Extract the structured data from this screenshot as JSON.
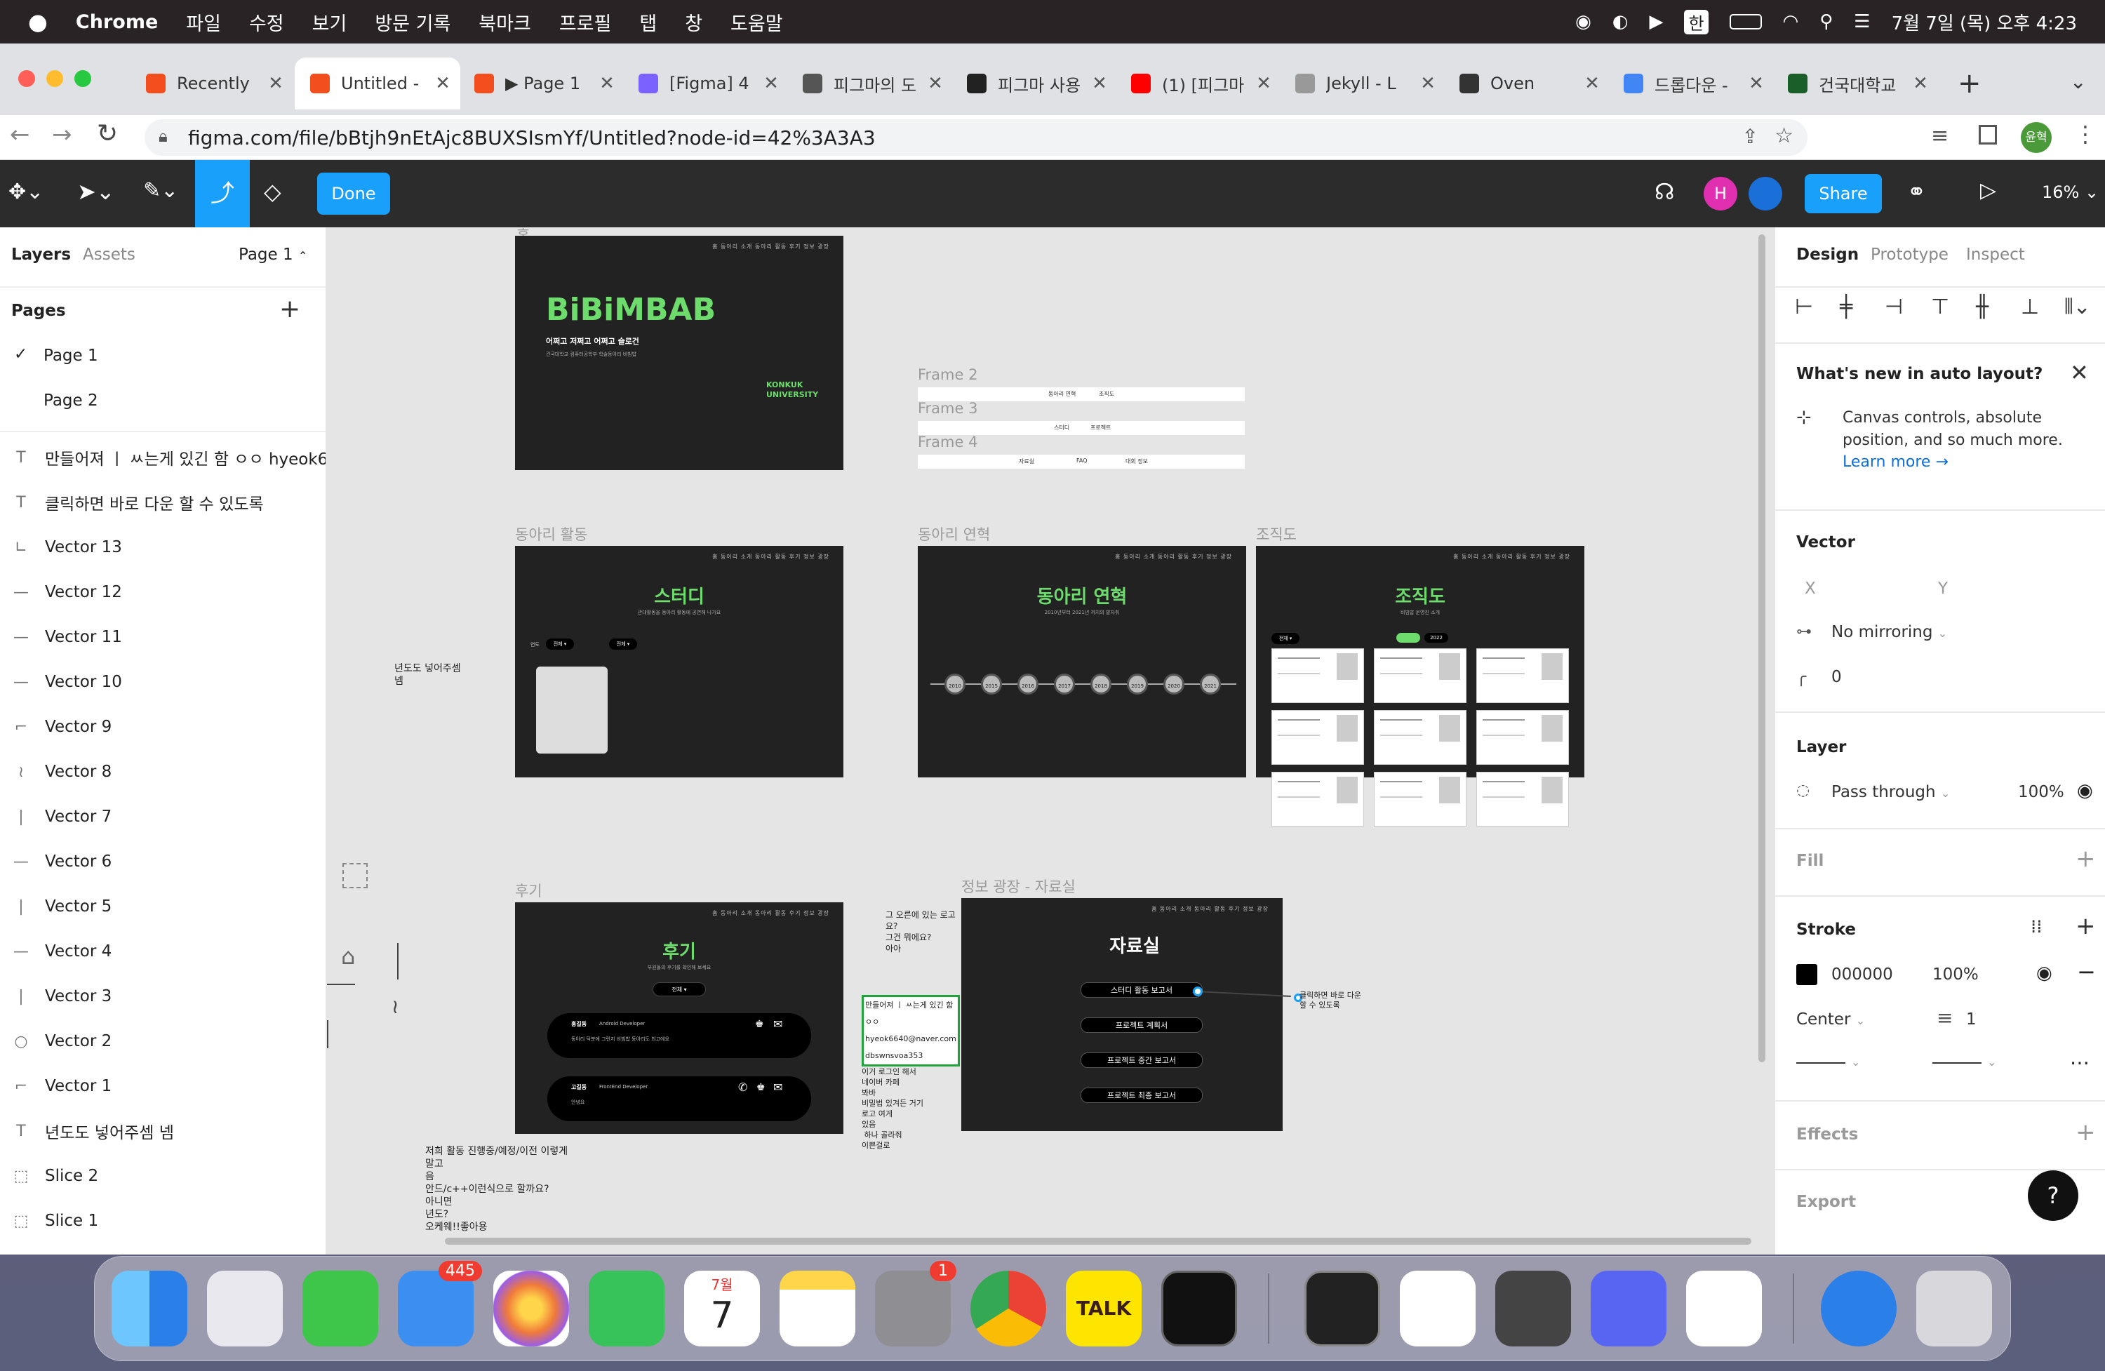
{
  "menubar": {
    "app": "Chrome",
    "items": [
      "파일",
      "수정",
      "보기",
      "방문 기록",
      "북마크",
      "프로필",
      "탭",
      "창",
      "도움말"
    ],
    "ime": "한",
    "datetime": "7월 7일 (목) 오후 4:23"
  },
  "tabs": [
    {
      "title": "Recently",
      "color": "#f24e1e"
    },
    {
      "title": "Untitled -",
      "color": "#f24e1e"
    },
    {
      "title": "▶ Page 1",
      "color": "#f24e1e"
    },
    {
      "title": "[Figma] 4",
      "color": "#7b61ff"
    },
    {
      "title": "피그마의 도",
      "color": "#555555"
    },
    {
      "title": "피그마 사용",
      "color": "#222222"
    },
    {
      "title": "(1) [피그마",
      "color": "#ff0000"
    },
    {
      "title": "Jekyll - L",
      "color": "#999999"
    },
    {
      "title": "Oven",
      "color": "#333333"
    },
    {
      "title": "드롭다운 -",
      "color": "#4285f4"
    },
    {
      "title": "건국대학교",
      "color": "#1a5e2a"
    }
  ],
  "address": {
    "url": "figma.com/file/bBtjh9nEtAjc8BUXSIsmYf/Untitled?node-id=42%3A3A3",
    "profile": "윤혁"
  },
  "figma_toolbar": {
    "done": "Done",
    "share": "Share",
    "zoom": "16%",
    "avatar_letter": "H"
  },
  "left_panel": {
    "tabs": {
      "layers": "Layers",
      "assets": "Assets",
      "page": "Page 1"
    },
    "pages_title": "Pages",
    "pages": [
      "Page 1",
      "Page 2"
    ],
    "layers": [
      {
        "name": "만들어져 ㅣ ㅆ는게 있긴 함 ㅇㅇ hyeok6...",
        "icon": "T"
      },
      {
        "name": "클릭하면 바로 다운 할 수 있도록",
        "icon": "T"
      },
      {
        "name": "Vector 13",
        "icon": "∟"
      },
      {
        "name": "Vector 12",
        "icon": "—"
      },
      {
        "name": "Vector 11",
        "icon": "—"
      },
      {
        "name": "Vector 10",
        "icon": "—"
      },
      {
        "name": "Vector 9",
        "icon": "⌐"
      },
      {
        "name": "Vector 8",
        "icon": "≀"
      },
      {
        "name": "Vector 7",
        "icon": "|"
      },
      {
        "name": "Vector 6",
        "icon": "—"
      },
      {
        "name": "Vector 5",
        "icon": "|"
      },
      {
        "name": "Vector 4",
        "icon": "—"
      },
      {
        "name": "Vector 3",
        "icon": "|"
      },
      {
        "name": "Vector 2",
        "icon": "○"
      },
      {
        "name": "Vector 1",
        "icon": "⌐"
      },
      {
        "name": "년도도 넣어주셈 넴",
        "icon": "T"
      },
      {
        "name": "Slice 2",
        "icon": "⬚"
      },
      {
        "name": "Slice 1",
        "icon": "⬚"
      }
    ]
  },
  "canvas": {
    "home": {
      "title": "BiBiMBAB",
      "sub": "어쩌고 저쩌고 어쩌고 슬로건",
      "small": "건국대학교 컴퓨터공학부 학술동아리 비빔밥",
      "univ1": "KONKUK",
      "univ2": "UNIVERSITY",
      "nav": "홈    동아리 소개    동아리 활동    후기    정보 광장"
    },
    "frame_labels": {
      "f2": "Frame 2",
      "f3": "Frame 3",
      "f4": "Frame 4"
    },
    "menu_rows": {
      "r1a": "동아리 연혁",
      "r1b": "조직도",
      "r2a": "스터디",
      "r2b": "프로젝트",
      "r3a": "자료실",
      "r3b": "FAQ",
      "r3c": "대회 정보"
    },
    "activity": {
      "label": "동아리 활동",
      "title": "스터디",
      "sub": "관대활동을 동아리 활동에 공연해 나가요",
      "filter1": "전체 ▾",
      "filter2": "전체 ▾",
      "year": "연도"
    },
    "history": {
      "label": "동아리 연혁",
      "title": "동아리 연혁",
      "sub": "2010년부터 2021년 까지의 발자취",
      "years": [
        "2010",
        "2015",
        "2016",
        "2017",
        "2018",
        "2019",
        "2020",
        "2021"
      ]
    },
    "org": {
      "label": "조직도",
      "title": "조직도",
      "sub": "비빔밥 운영진 소개",
      "year_badge": "2022",
      "filter": "전체 ▾"
    },
    "review": {
      "label": "후기",
      "title": "후기",
      "sub": "부원들의 후기를 확인해 보세요",
      "filter": "전체 ▾",
      "c1_name": "홍길동",
      "c1_role": "Android Developer",
      "c1_text": "동아리 덕분에 그런지 비빔밥 동아리도 최고에요",
      "c2_name": "고길동",
      "c2_role": "FrontEnd Developer",
      "c2_text": "안녕요"
    },
    "data_room": {
      "label": "정보 광장 - 자료실",
      "title": "자료실",
      "items": [
        "스터디 활동 보고서",
        "프로젝트 계획서",
        "프로젝트 중간 보고서",
        "프로젝트 최종 보고서"
      ]
    },
    "notes": {
      "year_note": "년도도 넣어주셈\n넴",
      "download_note": "클릭하면 바로 다운\n할 수 있도록",
      "logo_note": "그 오른에 있는 로고\n요?\n그건 뭐에요?\n아아",
      "email_box": "만들어져 ㅣ ㅆ는게 있긴 함\nㅇㅇ\nhyeok6640@naver.com\ndbswnsvoa353",
      "login_note": "이거 로그인 해서\n네이버 카페\n봐바\n비밀법 있겨든 거기\n로고 여게\n있음\n 하나 골라줘\n이쁜걸로",
      "activity_note": "저희 활동 진행중/예정/이전 이렇게\n말고\n음\n안드/c++이런식으로 할까요?\n아니면\n년도?\n오케웨!!좋아용"
    }
  },
  "right_panel": {
    "tabs": {
      "design": "Design",
      "prototype": "Prototype",
      "inspect": "Inspect"
    },
    "whats_new": {
      "title": "What's new in auto layout?",
      "body": "Canvas controls, absolute\nposition, and so much more.",
      "link": "Learn more →"
    },
    "vector": {
      "title": "Vector",
      "x": "X",
      "y": "Y",
      "mirroring": "No mirroring",
      "radius": "0"
    },
    "layer": {
      "title": "Layer",
      "mode": "Pass through",
      "opacity": "100%"
    },
    "fill": {
      "title": "Fill"
    },
    "stroke": {
      "title": "Stroke",
      "color": "000000",
      "opacity": "100%",
      "position": "Center",
      "weight": "1"
    },
    "effects": {
      "title": "Effects"
    },
    "export": {
      "title": "Export"
    }
  },
  "dock": {
    "mail_badge": "445",
    "settings_badge": "1",
    "calendar_month": "7월",
    "calendar_day": "7",
    "talk": "TALK"
  }
}
